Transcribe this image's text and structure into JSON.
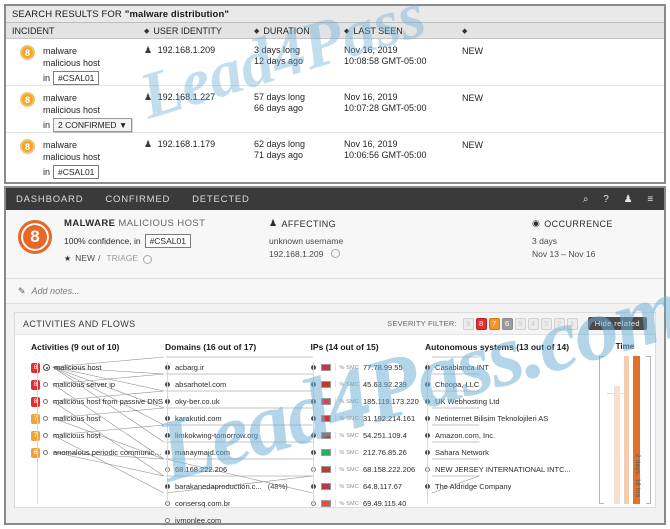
{
  "search": {
    "prefix": "SEARCH RESULTS FOR",
    "query": "\"malware distribution\""
  },
  "results_table": {
    "columns": [
      {
        "label": "INCIDENT",
        "sortable": false
      },
      {
        "label": "USER IDENTITY",
        "sortable": true
      },
      {
        "label": "DURATION",
        "sortable": true
      },
      {
        "label": "LAST SEEN",
        "sortable": true
      },
      {
        "label": "",
        "sortable": true
      }
    ],
    "rows": [
      {
        "severity": "8",
        "incident_line1": "malware",
        "incident_line2": "malicious host",
        "in_label": "in",
        "tag": "#CSAL01",
        "tag_type": "tag",
        "user_identity": "192.168.1.209",
        "duration_long": "3 days long",
        "duration_ago": "12 days ago",
        "last_seen_date": "Nov 16, 2019",
        "last_seen_time": "10:08:58 GMT-05:00",
        "status": "NEW"
      },
      {
        "severity": "8",
        "incident_line1": "malware",
        "incident_line2": "malicious host",
        "in_label": "in",
        "tag": "2 CONFIRMED ▼",
        "tag_type": "dropdown",
        "user_identity": "192.168.1.227",
        "duration_long": "57 days long",
        "duration_ago": "66 days ago",
        "last_seen_date": "Nov 16, 2019",
        "last_seen_time": "10:07:28 GMT-05:00",
        "status": "NEW"
      },
      {
        "severity": "8",
        "incident_line1": "malware",
        "incident_line2": "malicious host",
        "in_label": "in",
        "tag": "#CSAL01",
        "tag_type": "tag",
        "user_identity": "192.168.1.179",
        "duration_long": "62 days long",
        "duration_ago": "71 days ago",
        "last_seen_date": "Nov 16, 2019",
        "last_seen_time": "10:06:56 GMT-05:00",
        "status": "NEW"
      }
    ]
  },
  "nav": {
    "items": [
      "DASHBOARD",
      "CONFIRMED",
      "DETECTED"
    ],
    "icons": [
      "search-icon",
      "help-icon",
      "user-icon",
      "menu-icon"
    ],
    "icon_glyphs": [
      "⌕",
      "?",
      "♟",
      "≡"
    ]
  },
  "incident_summary": {
    "severity": "8",
    "title_strong": "MALWARE",
    "title_light": "MALICIOUS HOST",
    "confidence": "100% confidence, in",
    "confidence_tag": "#CSAL01",
    "status": "NEW",
    "status_sep": "/",
    "triage": "TRIAGE",
    "affecting_label": "AFFECTING",
    "affecting_user": "unknown username",
    "affecting_ip": "192.168.1.209",
    "occurrence_label": "OCCURRENCE",
    "occurrence_days": "3 days",
    "occurrence_range": "Nov 13 – Nov 16"
  },
  "notes": {
    "placeholder": "Add notes..."
  },
  "activities_flows": {
    "title": "ACTIVITIES AND FLOWS",
    "severity_filter_label": "SEVERITY FILTER:",
    "severity_chips": [
      {
        "value": "9",
        "state": "off"
      },
      {
        "value": "8",
        "state": "red"
      },
      {
        "value": "7",
        "state": "orange"
      },
      {
        "value": "6",
        "state": "gray"
      },
      {
        "value": "5",
        "state": "off"
      },
      {
        "value": "4",
        "state": "off"
      },
      {
        "value": "3",
        "state": "off"
      },
      {
        "value": "2",
        "state": "off"
      },
      {
        "value": "1",
        "state": "off"
      }
    ],
    "hide_related": "Hide related",
    "columns": {
      "activities": "Activities (9 out of 10)",
      "domains": "Domains (16 out of 17)",
      "ips": "IPs (14 out of 15)",
      "autonomous": "Autonomous systems (13 out of 14)",
      "time": "Time"
    },
    "activities": [
      {
        "severity": "8",
        "sev_color": "red",
        "marker": "ring",
        "label": "malicious host"
      },
      {
        "severity": "8",
        "sev_color": "red",
        "marker": "open",
        "label": "malicious server ip"
      },
      {
        "severity": "8",
        "sev_color": "red",
        "marker": "open",
        "label": "malicious host from passive DNS"
      },
      {
        "severity": "7",
        "sev_color": "orange",
        "marker": "open",
        "label": "malicious host"
      },
      {
        "severity": "7",
        "sev_color": "orange",
        "marker": "open",
        "label": "malicious host"
      },
      {
        "severity": "6",
        "sev_color": "orange",
        "marker": "open",
        "label": "anomalous periodic communicat..."
      }
    ],
    "domains": [
      {
        "marker": "filled",
        "label": "acbarg.ir"
      },
      {
        "marker": "filled",
        "label": "absarhotel.com"
      },
      {
        "marker": "filled",
        "label": "oky-ber.co.uk"
      },
      {
        "marker": "filled",
        "label": "karakutid.com"
      },
      {
        "marker": "filled",
        "label": "limkokwing-tomorrow.org"
      },
      {
        "marker": "filled",
        "label": "manaymajd.com"
      },
      {
        "marker": "open",
        "label": "68.168.222.206"
      },
      {
        "marker": "filled",
        "label": "barakanedaproduction.c...",
        "pct": "(48%)"
      },
      {
        "marker": "open",
        "label": "consersq.com.br"
      },
      {
        "marker": "open",
        "label": "jvmonlee.com"
      }
    ],
    "ips": [
      {
        "marker": "filled",
        "flag": "#c9334a",
        "smc": "% SMC",
        "label": "77.78.99.55"
      },
      {
        "marker": "filled",
        "flag": "#c0392b",
        "smc": "% SMC",
        "label": "45.63.92.239"
      },
      {
        "marker": "filled",
        "flag": "#d7455c",
        "smc": "% SMC",
        "label": "185.119.173.220"
      },
      {
        "marker": "filled",
        "flag": "#d32f2f",
        "smc": "% SMC",
        "label": "31.192.214.161"
      },
      {
        "marker": "filled",
        "flag": "#c0392b",
        "smc": "% SMC",
        "label": "54.251.109.4"
      },
      {
        "marker": "filled",
        "flag": "#27ae60",
        "smc": "% SMC",
        "label": "212.76.85.26"
      },
      {
        "marker": "open",
        "flag": "#c0392b",
        "smc": "% SMC",
        "label": "68.158.222.206"
      },
      {
        "marker": "filled",
        "flag": "#b03a48",
        "smc": "% SMC",
        "label": "64.8.117.67"
      },
      {
        "marker": "open",
        "flag": "#e74c3c",
        "smc": "% SMC",
        "label": "69.49.115.40"
      }
    ],
    "autonomous_systems": [
      {
        "marker": "filled",
        "label": "Casablanca INT"
      },
      {
        "marker": "filled",
        "label": "Choopa, LLC"
      },
      {
        "marker": "filled",
        "label": "UK Webhosting Ltd"
      },
      {
        "marker": "filled",
        "label": "Netinternet Bilisim Teknolojileri AS"
      },
      {
        "marker": "filled",
        "label": "Amazon.com, Inc."
      },
      {
        "marker": "filled",
        "label": "Sahara Network"
      },
      {
        "marker": "open",
        "label": "NEW  JERSEY INTERNATIONAL INTC..."
      },
      {
        "marker": "filled",
        "label": "The Aldridge Company"
      }
    ],
    "time_bar_label": "2 days, 18 hrs"
  },
  "watermark": {
    "line1": "Lead4Pass.com",
    "line2": "Lead4Pass"
  },
  "colors": {
    "severity_orange": "#e8682a",
    "badge_amber": "#f5a623",
    "sev_red": "#e03030",
    "nav_dark": "#3a3a3a"
  }
}
